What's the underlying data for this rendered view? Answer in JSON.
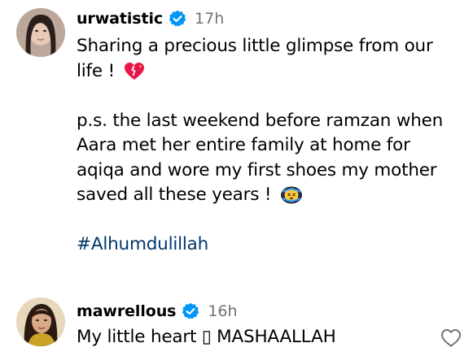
{
  "comments": [
    {
      "username": "urwatistic",
      "time": "17h",
      "lines": [
        "Sharing a precious little glimpse from our",
        "life ! ",
        "",
        "p.s. the last weekend before ramzan when",
        "Aara met her entire family at home for",
        "aqiqa and wore my first shoes my mother",
        "saved all these years ! ",
        "",
        "#Alhumdulillah"
      ],
      "emojis": [
        "sparkling-heart-emoji",
        "dizzy-face-emoji"
      ],
      "verified_icon": "verified-badge-icon",
      "hashtag": "#Alhumdulillah"
    },
    {
      "username": "mawrellous",
      "time": "16h",
      "text": "My little heart ▯ MASHAALLAH",
      "verified_icon": "verified-badge-icon",
      "like_icon": "heart-outline-icon"
    }
  ],
  "colors": {
    "text": "#000000",
    "muted": "#737373",
    "verified": "#0095f6",
    "hashtag": "#00376b"
  }
}
